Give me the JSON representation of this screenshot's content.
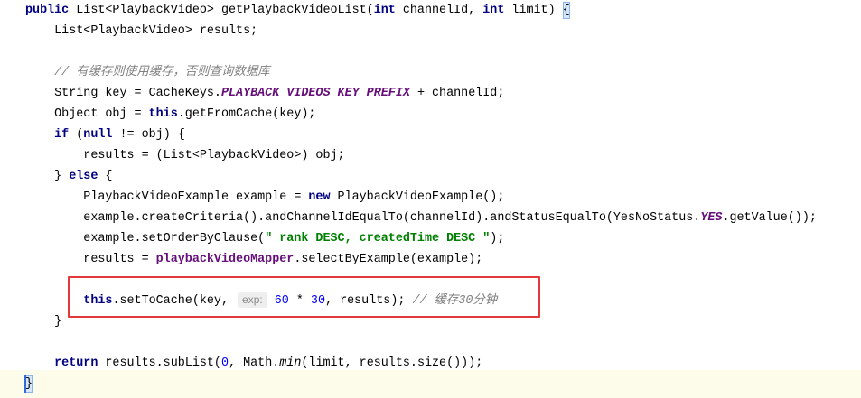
{
  "editor": {
    "lines": [
      [
        "public",
        " List<PlaybackVideo> getPlaybackVideoList(",
        "int",
        " channelId, ",
        "int",
        " limit) ",
        "{"
      ],
      [
        "List<PlaybackVideo> results;"
      ],
      [],
      [
        "// 有缓存则使用缓存，否则查询数据库"
      ],
      [
        "String key = CacheKeys.",
        "PLAYBACK_VIDEOS_KEY_PREFIX",
        " + channelId;"
      ],
      [
        "Object obj = ",
        "this",
        ".getFromCache(key);"
      ],
      [
        "if",
        " (",
        "null",
        " != obj) {"
      ],
      [
        "results = (List<PlaybackVideo>) obj;"
      ],
      [
        "} ",
        "else",
        " {"
      ],
      [
        "PlaybackVideoExample example = ",
        "new",
        " PlaybackVideoExample();"
      ],
      [
        "example.createCriteria().andChannelIdEqualTo(channelId).andStatusEqualTo(YesNoStatus.",
        "YES",
        ".getValue());"
      ],
      [
        "example.setOrderByClause(",
        "\" rank DESC, createdTime DESC \"",
        ");"
      ],
      [
        "results = ",
        "playbackVideoMapper",
        ".selectByExample(example);"
      ],
      [],
      [
        "this",
        ".setToCache(key, ",
        "exp:",
        "60",
        " * ",
        "30",
        ", results); ",
        "// 缓存30分钟"
      ],
      [
        "}"
      ],
      [],
      [
        "return",
        " results.subList(",
        "0",
        ", Math.",
        "min",
        "(limit, results.size()));"
      ],
      [
        "}"
      ]
    ]
  }
}
